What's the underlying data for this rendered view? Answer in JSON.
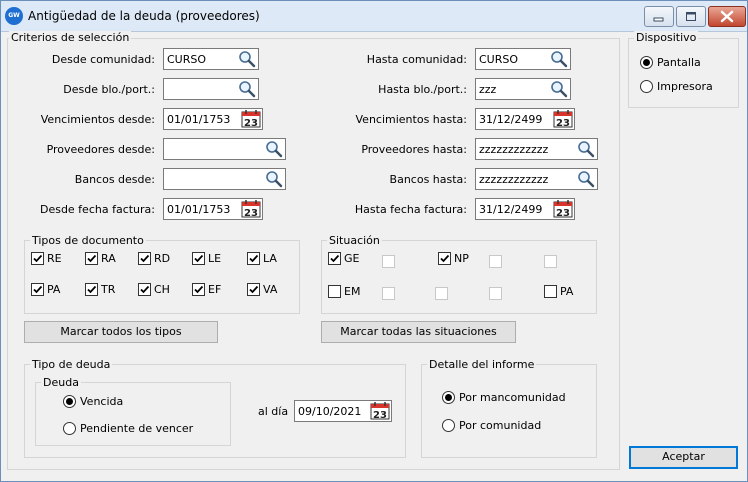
{
  "window": {
    "title": "Antigüedad de la deuda (proveedores)",
    "app_icon_text": "GW"
  },
  "criterios": {
    "title": "Criterios de selección",
    "desde_comunidad": {
      "label": "Desde comunidad:",
      "value": "CURSO"
    },
    "desde_bloque": {
      "label": "Desde blo./port.:",
      "value": ""
    },
    "vencimientos_desde": {
      "label": "Vencimientos desde:",
      "value": "01/01/1753"
    },
    "proveedores_desde": {
      "label": "Proveedores desde:",
      "value": ""
    },
    "bancos_desde": {
      "label": "Bancos desde:",
      "value": ""
    },
    "desde_fecha_factura": {
      "label": "Desde fecha factura:",
      "value": "01/01/1753"
    },
    "hasta_comunidad": {
      "label": "Hasta comunidad:",
      "value": "CURSO"
    },
    "hasta_bloque": {
      "label": "Hasta blo./port.:",
      "value": "zzz"
    },
    "vencimientos_hasta": {
      "label": "Vencimientos hasta:",
      "value": "31/12/2499"
    },
    "proveedores_hasta": {
      "label": "Proveedores hasta:",
      "value": "zzzzzzzzzzzz"
    },
    "bancos_hasta": {
      "label": "Bancos hasta:",
      "value": "zzzzzzzzzzzz"
    },
    "hasta_fecha_factura": {
      "label": "Hasta fecha factura:",
      "value": "31/12/2499"
    }
  },
  "calendar_day": "23",
  "tipos_documento": {
    "title": "Tipos de documento",
    "items": [
      {
        "label": "RE",
        "checked": true
      },
      {
        "label": "RA",
        "checked": true
      },
      {
        "label": "RD",
        "checked": true
      },
      {
        "label": "LE",
        "checked": true
      },
      {
        "label": "LA",
        "checked": true
      },
      {
        "label": "PA",
        "checked": true
      },
      {
        "label": "TR",
        "checked": true
      },
      {
        "label": "CH",
        "checked": true
      },
      {
        "label": "EF",
        "checked": true
      },
      {
        "label": "VA",
        "checked": true
      }
    ]
  },
  "situacion": {
    "title": "Situación",
    "ge": {
      "label": "GE",
      "checked": true
    },
    "np": {
      "label": "NP",
      "checked": true
    },
    "em": {
      "label": "EM",
      "checked": false
    },
    "pa": {
      "label": "PA",
      "checked": false
    }
  },
  "buttons": {
    "marcar_tipos": "Marcar todos los tipos",
    "marcar_situaciones": "Marcar todas las situaciones",
    "aceptar": "Aceptar"
  },
  "tipo_deuda": {
    "title": "Tipo de deuda",
    "deuda_title": "Deuda",
    "vencida": "Vencida",
    "pendiente": "Pendiente de vencer",
    "selected": "vencida",
    "al_dia_label": "al día",
    "al_dia_value": "09/10/2021"
  },
  "detalle": {
    "title": "Detalle del informe",
    "por_mancomunidad": "Por mancomunidad",
    "por_comunidad": "Por comunidad",
    "selected": "por_mancomunidad"
  },
  "dispositivo": {
    "title": "Dispositivo",
    "pantalla": "Pantalla",
    "impresora": "Impresora",
    "selected": "pantalla"
  }
}
